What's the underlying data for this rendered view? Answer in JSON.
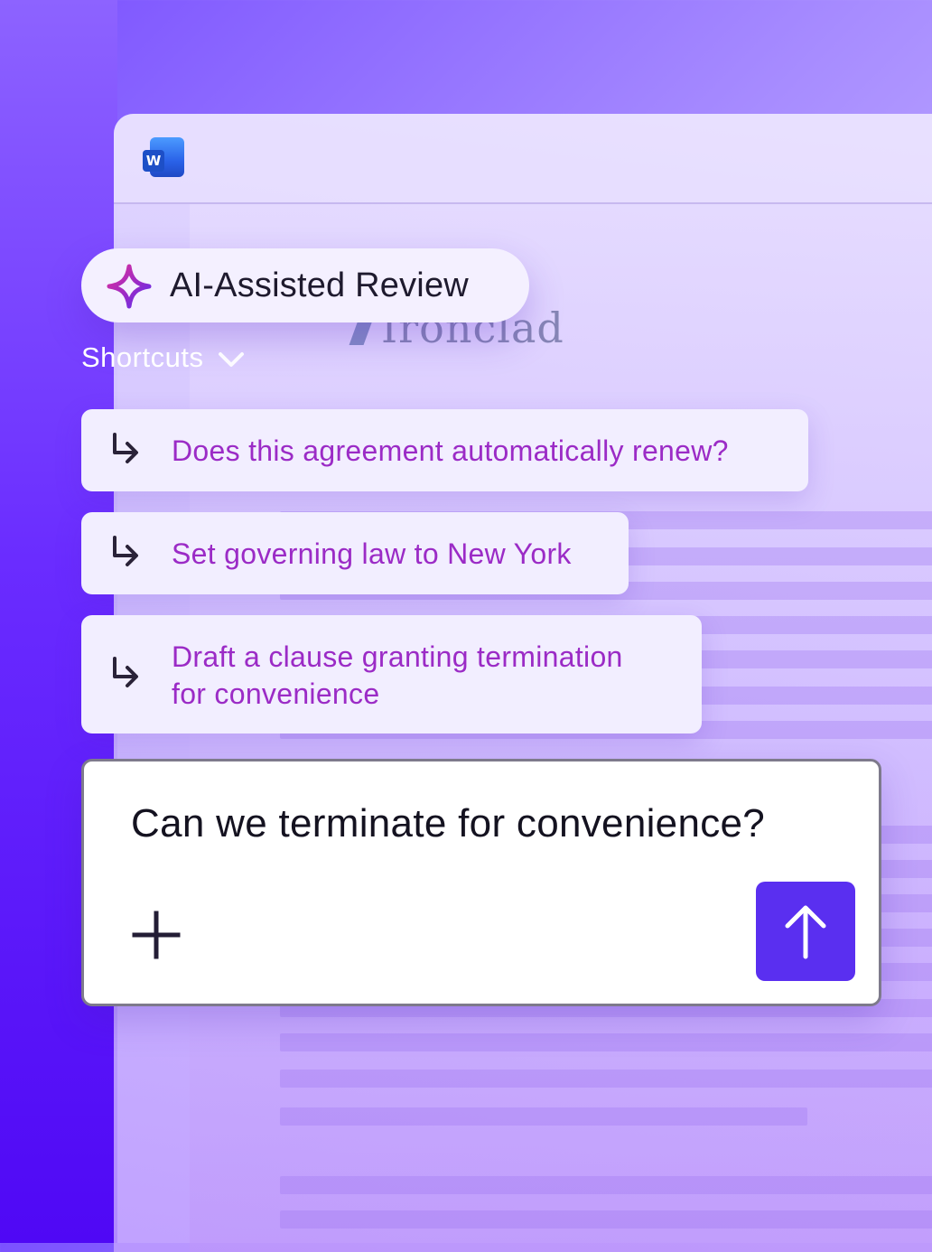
{
  "window": {
    "app_icon": "word-icon",
    "app_icon_letter": "W"
  },
  "document": {
    "logo_text": "Ironclad"
  },
  "assistant": {
    "title": "AI-Assisted Review",
    "title_icon": "sparkle-icon",
    "shortcuts_label": "Shortcuts",
    "shortcuts_icon": "chevron-down-icon",
    "suggestions": [
      {
        "lines": [
          "Does this agreement automatically renew?"
        ],
        "icon": "return-arrow-icon"
      },
      {
        "lines": [
          "Set governing law to New York"
        ],
        "icon": "return-arrow-icon"
      },
      {
        "lines": [
          "Draft a clause granting termination",
          "for convenience"
        ],
        "icon": "return-arrow-icon"
      }
    ],
    "input": {
      "value": "Can we terminate for convenience?",
      "add_icon": "plus-icon",
      "send_icon": "arrow-up-icon"
    }
  },
  "colors": {
    "accent": "#5a2ff0",
    "suggestion_text": "#9b2bc6",
    "background_start": "#7b52ff",
    "background_end": "#d9cdfb"
  }
}
